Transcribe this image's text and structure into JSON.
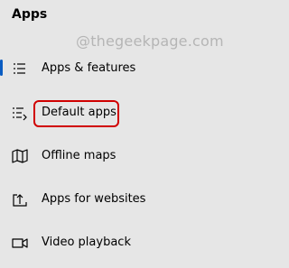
{
  "section_title": "Apps",
  "watermark": "@thegeekpage.com",
  "colors": {
    "background": "#e6e6e6",
    "accent": "#0a5cc2",
    "highlight": "#d00000",
    "text": "#000000",
    "watermark": "#b5b5b5"
  },
  "nav_items": [
    {
      "label": "Apps & features",
      "icon": "list-icon",
      "selected": true
    },
    {
      "label": "Default apps",
      "icon": "default-apps-icon",
      "selected": false,
      "highlighted": true
    },
    {
      "label": "Offline maps",
      "icon": "map-icon",
      "selected": false
    },
    {
      "label": "Apps for websites",
      "icon": "open-in-app-icon",
      "selected": false
    },
    {
      "label": "Video playback",
      "icon": "video-icon",
      "selected": false
    }
  ]
}
